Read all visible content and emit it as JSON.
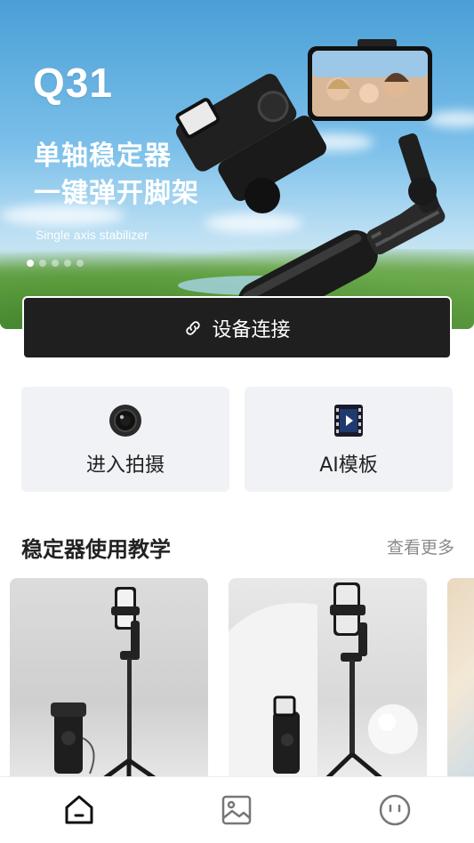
{
  "banner": {
    "model": "Q31",
    "headline_line1": "单轴稳定器",
    "headline_line2": "一键弹开脚架",
    "subtitle": "Single axis stabilizer",
    "carousel_count": 5,
    "carousel_active_index": 0
  },
  "connect": {
    "label": "设备连接",
    "icon": "link-icon"
  },
  "actions": [
    {
      "label": "进入拍摄",
      "icon": "camera-lens-icon"
    },
    {
      "label": "AI模板",
      "icon": "film-play-icon"
    }
  ],
  "tutorials": {
    "title": "稳定器使用教学",
    "more_label": "查看更多"
  },
  "tabbar": {
    "items": [
      {
        "icon": "home-icon",
        "active": true
      },
      {
        "icon": "gallery-icon",
        "active": false
      },
      {
        "icon": "profile-face-icon",
        "active": false
      }
    ]
  },
  "colors": {
    "primary_dark": "#1f1f1f",
    "card_bg": "#f1f2f6",
    "muted_text": "#8a8a8a"
  }
}
